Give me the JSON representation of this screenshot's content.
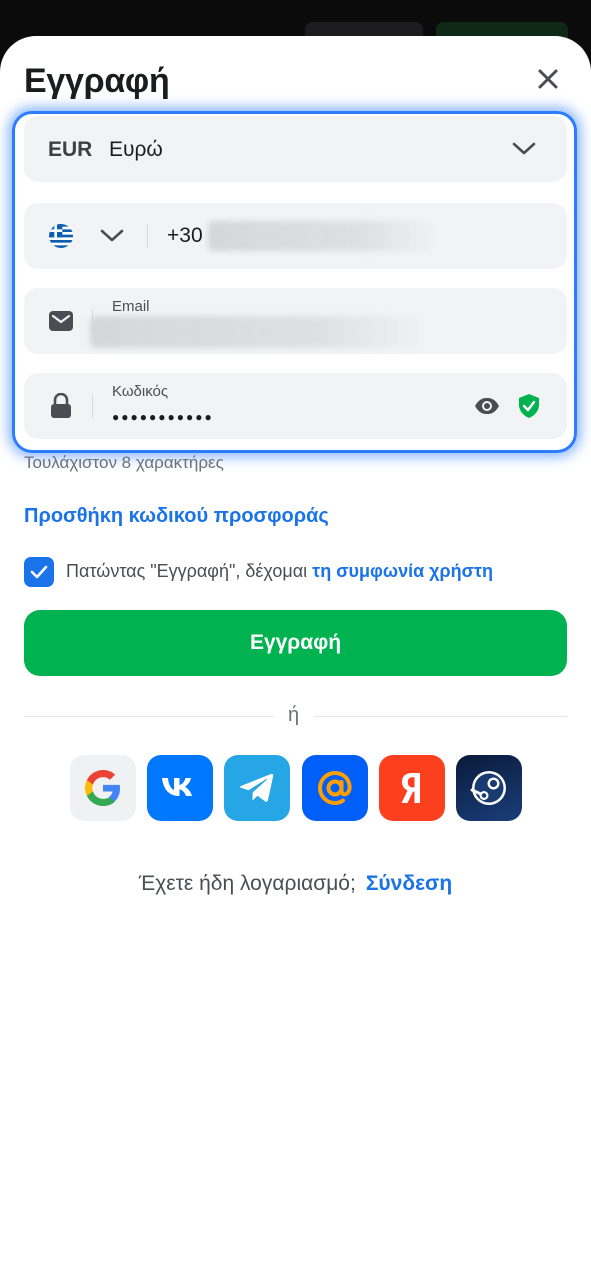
{
  "title": "Εγγραφή",
  "currency": {
    "code": "EUR",
    "name": "Ευρώ"
  },
  "phone": {
    "prefix": "+30"
  },
  "email": {
    "label": "Email"
  },
  "password": {
    "label": "Κωδικός",
    "masked_value": "●●●●●●●●●●●",
    "hint": "Τουλάχιστον 8 χαρακτήρες"
  },
  "promo_link": "Προσθήκη κωδικού προσφοράς",
  "terms": {
    "checked": true,
    "text": "Πατώντας \"Εγγραφή\", δέχομαι ",
    "link": "τη συμφωνία χρήστη"
  },
  "submit_label": "Εγγραφή",
  "divider_text": "ή",
  "social": [
    "google-icon",
    "vk-icon",
    "telegram-icon",
    "mail-ru-icon",
    "yandex-icon",
    "steam-icon"
  ],
  "footer": {
    "question": "Έχετε ήδη λογαριασμό;",
    "login_link": "Σύνδεση"
  },
  "colors": {
    "accent": "#1a73e8",
    "primary_button": "#00b350",
    "focus_ring": "#2b7cff"
  }
}
